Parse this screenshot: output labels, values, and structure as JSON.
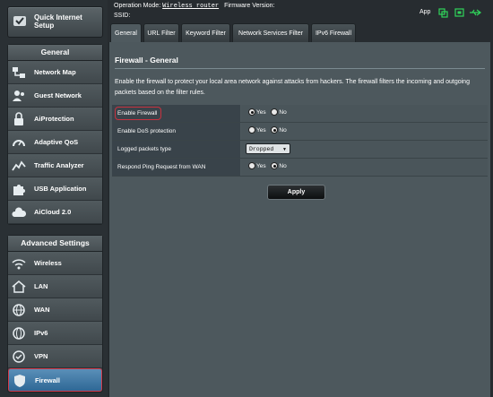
{
  "header": {
    "operation_mode_label": "Operation Mode:",
    "operation_mode_value": "Wireless router",
    "firmware_label": "Firmware Version:",
    "ssid_label": "SSID:",
    "app_label": "App",
    "status_icons": [
      "network-icon",
      "wifi-icon",
      "usb-icon"
    ],
    "accent_color": "#2fd45a"
  },
  "sidebar": {
    "quick_setup": "Quick Internet Setup",
    "general_title": "General",
    "general_items": [
      {
        "label": "Network Map",
        "icon": "network-map-icon"
      },
      {
        "label": "Guest Network",
        "icon": "guest-network-icon"
      },
      {
        "label": "AiProtection",
        "icon": "lock-icon"
      },
      {
        "label": "Adaptive QoS",
        "icon": "speedometer-icon"
      },
      {
        "label": "Traffic Analyzer",
        "icon": "chart-line-icon"
      },
      {
        "label": "USB Application",
        "icon": "puzzle-icon"
      },
      {
        "label": "AiCloud 2.0",
        "icon": "cloud-icon"
      }
    ],
    "advanced_title": "Advanced Settings",
    "advanced_items": [
      {
        "label": "Wireless",
        "icon": "wifi-icon"
      },
      {
        "label": "LAN",
        "icon": "home-icon"
      },
      {
        "label": "WAN",
        "icon": "globe-icon"
      },
      {
        "label": "IPv6",
        "icon": "ipv6-globe-icon"
      },
      {
        "label": "VPN",
        "icon": "vpn-icon"
      },
      {
        "label": "Firewall",
        "icon": "shield-icon",
        "active": true
      }
    ]
  },
  "tabs": [
    {
      "label": "General",
      "active": true
    },
    {
      "label": "URL Filter"
    },
    {
      "label": "Keyword Filter"
    },
    {
      "label": "Network Services Filter"
    },
    {
      "label": "IPv6 Firewall"
    }
  ],
  "page": {
    "title": "Firewall - General",
    "description": "Enable the firewall to protect your local area network against attacks from hackers. The firewall filters the incoming and outgoing packets based on the filter rules.",
    "settings": [
      {
        "label": "Enable Firewall",
        "type": "radio",
        "options": [
          "Yes",
          "No"
        ],
        "selected": "Yes",
        "highlighted": true
      },
      {
        "label": "Enable DoS protection",
        "type": "radio",
        "options": [
          "Yes",
          "No"
        ],
        "selected": "No"
      },
      {
        "label": "Logged packets type",
        "type": "select",
        "value": "Dropped"
      },
      {
        "label": "Respond Ping Request from WAN",
        "type": "radio",
        "options": [
          "Yes",
          "No"
        ],
        "selected": "No"
      }
    ],
    "apply_label": "Apply"
  }
}
